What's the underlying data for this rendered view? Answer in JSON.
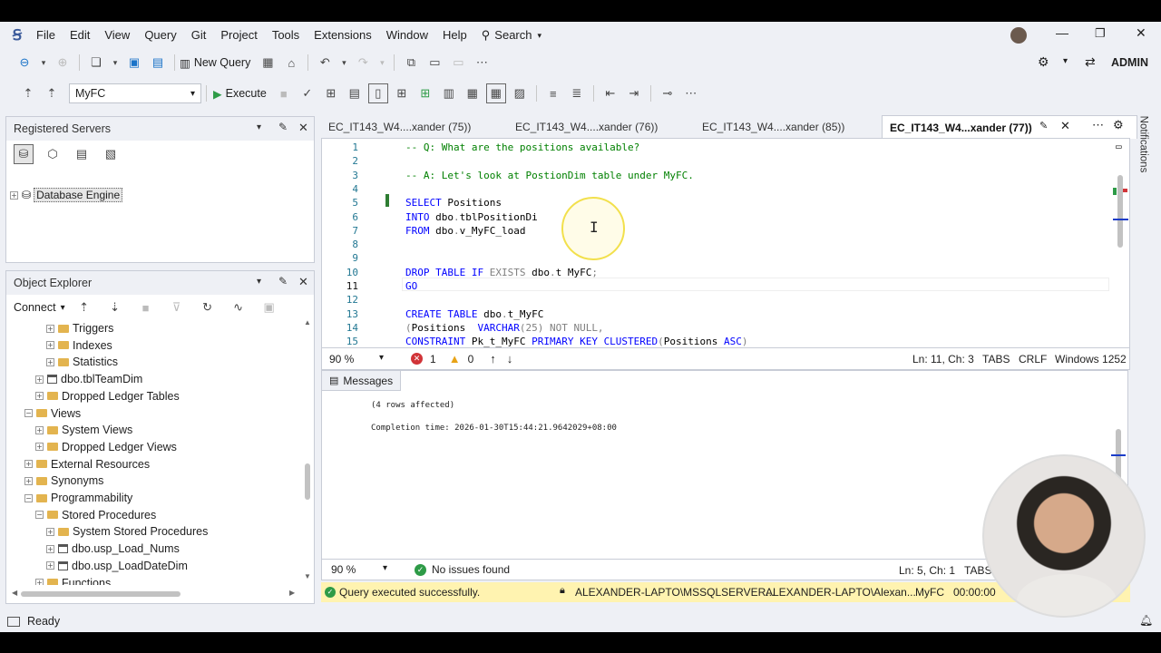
{
  "menu": [
    "File",
    "Edit",
    "View",
    "Query",
    "Git",
    "Project",
    "Tools",
    "Extensions",
    "Window",
    "Help"
  ],
  "search_label": "Search",
  "account_label": "ADMIN",
  "toolbar": {
    "new_query": "New Query",
    "database": "MyFC",
    "execute": "Execute"
  },
  "registered_servers": {
    "title": "Registered Servers",
    "item": "Database Engine"
  },
  "object_explorer": {
    "title": "Object Explorer",
    "connect": "Connect",
    "items": [
      {
        "label": "Triggers",
        "indent": 3,
        "kind": "folder",
        "exp": "+"
      },
      {
        "label": "Indexes",
        "indent": 3,
        "kind": "folder",
        "exp": "+"
      },
      {
        "label": "Statistics",
        "indent": 3,
        "kind": "folder",
        "exp": "+"
      },
      {
        "label": "dbo.tblTeamDim",
        "indent": 2,
        "kind": "table",
        "exp": "+"
      },
      {
        "label": "Dropped Ledger Tables",
        "indent": 2,
        "kind": "folder",
        "exp": "+"
      },
      {
        "label": "Views",
        "indent": 1,
        "kind": "folder",
        "exp": "-"
      },
      {
        "label": "System Views",
        "indent": 2,
        "kind": "folder",
        "exp": "+"
      },
      {
        "label": "Dropped Ledger Views",
        "indent": 2,
        "kind": "folder",
        "exp": "+"
      },
      {
        "label": "External Resources",
        "indent": 1,
        "kind": "folder",
        "exp": "+"
      },
      {
        "label": "Synonyms",
        "indent": 1,
        "kind": "folder",
        "exp": "+"
      },
      {
        "label": "Programmability",
        "indent": 1,
        "kind": "folder",
        "exp": "-"
      },
      {
        "label": "Stored Procedures",
        "indent": 2,
        "kind": "folder",
        "exp": "-"
      },
      {
        "label": "System Stored Procedures",
        "indent": 3,
        "kind": "folder",
        "exp": "+"
      },
      {
        "label": "dbo.usp_Load_Nums",
        "indent": 3,
        "kind": "table",
        "exp": "+"
      },
      {
        "label": "dbo.usp_LoadDateDim",
        "indent": 3,
        "kind": "table",
        "exp": "+"
      },
      {
        "label": "Functions",
        "indent": 2,
        "kind": "folder",
        "exp": "+"
      }
    ]
  },
  "doc_tabs": [
    {
      "label": "EC_IT143_W4....xander (75))",
      "active": false
    },
    {
      "label": "EC_IT143_W4....xander (76))",
      "active": false
    },
    {
      "label": "EC_IT143_W4....xander (85))",
      "active": false
    },
    {
      "label": "EC_IT143_W4...xander (77))",
      "active": true
    }
  ],
  "code_lines": [
    {
      "n": "1",
      "html": [
        [
          "cm",
          "-- Q: What are the positions available?"
        ]
      ]
    },
    {
      "n": "2",
      "html": []
    },
    {
      "n": "3",
      "html": [
        [
          "cm",
          "-- A: Let's look at PostionDim table under MyFC."
        ]
      ]
    },
    {
      "n": "4",
      "html": []
    },
    {
      "n": "5",
      "html": [
        [
          "kw",
          "SELECT "
        ],
        [
          "id",
          "Positions"
        ]
      ]
    },
    {
      "n": "6",
      "html": [
        [
          "kw",
          "INTO "
        ],
        [
          "id",
          "dbo"
        ],
        [
          "gr",
          "."
        ],
        [
          "id",
          "tblPositionDi"
        ]
      ]
    },
    {
      "n": "7",
      "html": [
        [
          "kw",
          "FROM "
        ],
        [
          "id",
          "dbo"
        ],
        [
          "gr",
          "."
        ],
        [
          "id",
          "v_MyFC_load"
        ]
      ]
    },
    {
      "n": "8",
      "html": []
    },
    {
      "n": "9",
      "html": []
    },
    {
      "n": "10",
      "html": [
        [
          "kw",
          "DROP TABLE IF "
        ],
        [
          "gr",
          "EXISTS "
        ],
        [
          "id",
          "dbo"
        ],
        [
          "gr",
          "."
        ],
        [
          "id",
          "t_MyFC"
        ],
        [
          "gr",
          ";"
        ]
      ]
    },
    {
      "n": "11",
      "html": [
        [
          "kw",
          "GO"
        ]
      ]
    },
    {
      "n": "12",
      "html": []
    },
    {
      "n": "13",
      "html": [
        [
          "kw",
          "CREATE TABLE "
        ],
        [
          "id",
          "dbo"
        ],
        [
          "gr",
          "."
        ],
        [
          "id",
          "t_MyFC"
        ]
      ]
    },
    {
      "n": "14",
      "html": [
        [
          "gr",
          "("
        ],
        [
          "id",
          "Positions  "
        ],
        [
          "kw",
          "VARCHAR"
        ],
        [
          "gr",
          "(25) NOT NULL,"
        ]
      ]
    },
    {
      "n": "15",
      "html": [
        [
          "kw",
          "CONSTRAINT "
        ],
        [
          "id",
          "Pk_t_MyFC "
        ],
        [
          "kw",
          "PRIMARY KEY CLUSTERED"
        ],
        [
          "gr",
          "("
        ],
        [
          "id",
          "Positions "
        ],
        [
          "kw",
          "ASC"
        ],
        [
          "gr",
          ")"
        ]
      ]
    }
  ],
  "editor_status": {
    "zoom": "90 %",
    "errors": "1",
    "warnings": "0",
    "position": "Ln: 11, Ch: 3",
    "tabs": "TABS",
    "eol": "CRLF",
    "encoding": "Windows 1252"
  },
  "messages": {
    "tab": "Messages",
    "rows_affected": "(4 rows affected)",
    "completion": "Completion time: 2026-01-30T15:44:21.9642029+08:00"
  },
  "results_status": {
    "zoom": "90 %",
    "issues": "No issues found",
    "position": "Ln: 5, Ch: 1",
    "tabs": "TABS"
  },
  "query_bar": {
    "message": "Query executed successfully.",
    "server": "ALEXANDER-LAPTO\\MSSQLSERVER...",
    "user": "ALEXANDER-LAPTO\\Alexan...",
    "db": "MyFC",
    "time": "00:00:00"
  },
  "notifications_label": "Notifications",
  "status_bar": {
    "ready": "Ready"
  },
  "colors": {
    "accent": "#0078d4",
    "query_bar": "#fff3b0",
    "success": "#2e9b47",
    "error": "#d13438",
    "warning": "#e8a317"
  }
}
